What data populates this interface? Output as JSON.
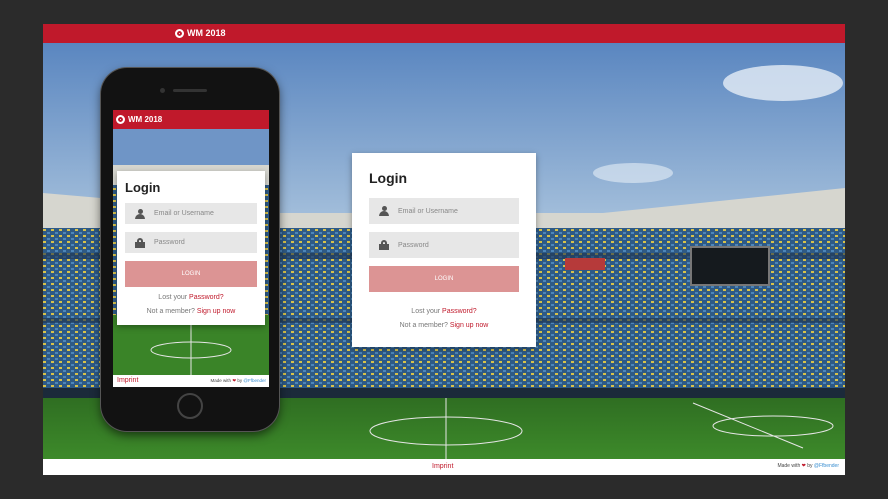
{
  "app": {
    "brand": "WM 2018"
  },
  "login": {
    "title": "Login",
    "email_placeholder": "Email or Username",
    "password_placeholder": "Password",
    "button_label": "LOGIN",
    "lost_prefix": "Lost your",
    "lost_link": "Password?",
    "member_prefix": "Not a member?",
    "signup_link": "Sign up now"
  },
  "footer": {
    "imprint": "Imprint",
    "made_with": "Made with",
    "by": "by",
    "author": "@Ffbender"
  },
  "colors": {
    "brand_red": "#c0192b",
    "login_button": "#dc9494",
    "link_blue": "#3a8fd1"
  },
  "icons": [
    "soccer-ball-icon",
    "user-icon",
    "lock-icon",
    "heart-icon"
  ]
}
